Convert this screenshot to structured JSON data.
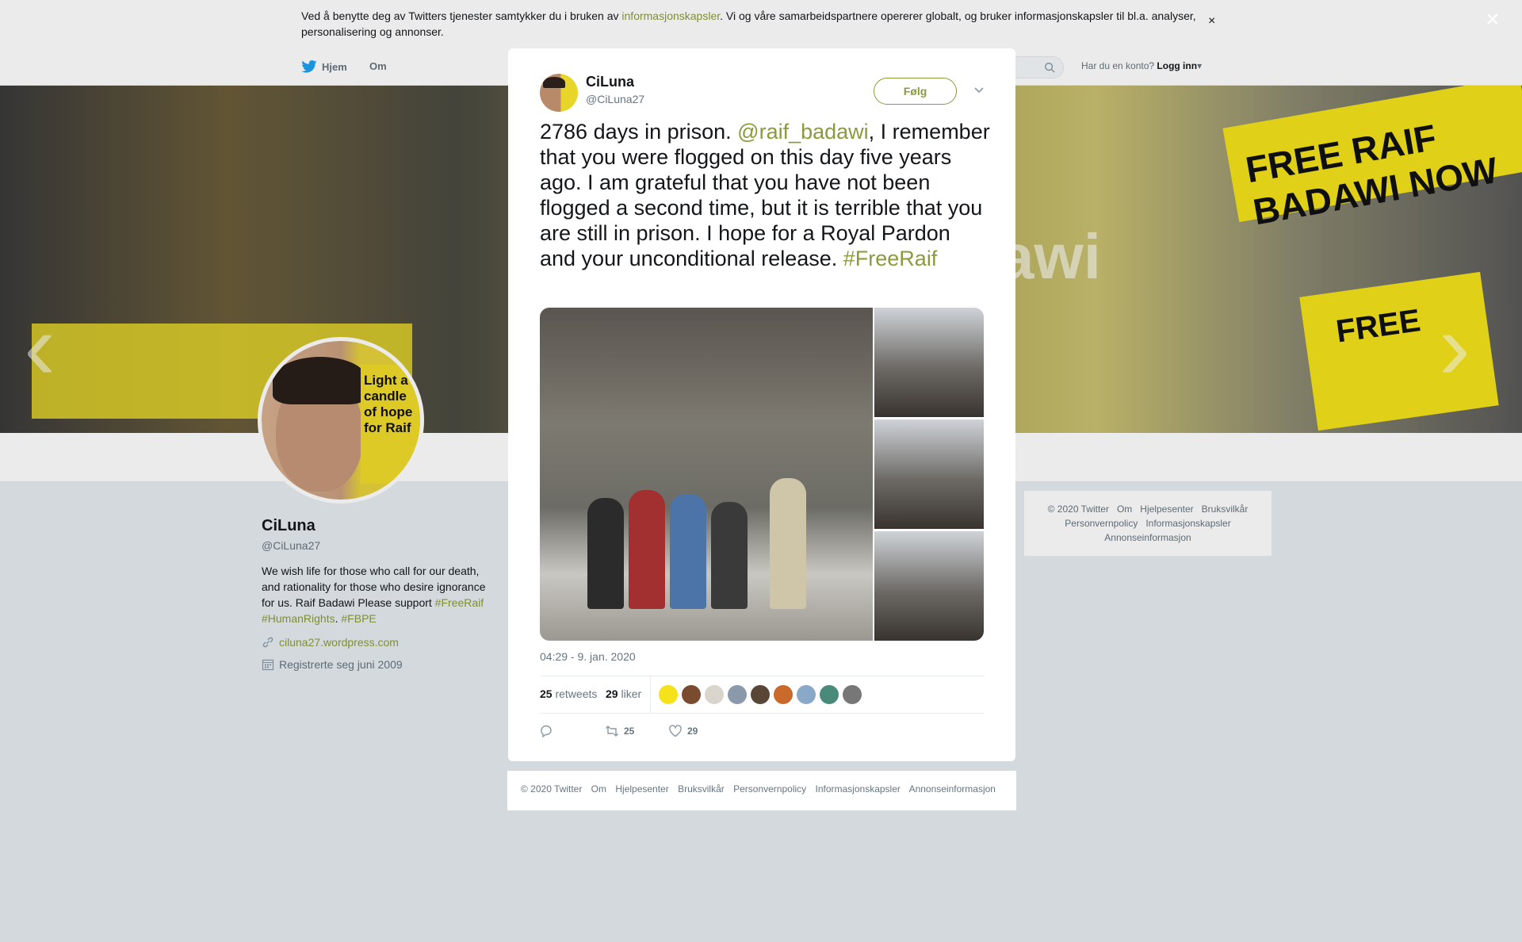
{
  "cookie_bar": {
    "text_before": "Ved å benytte deg av Twitters tjenester samtykker du i bruken av ",
    "link": "informasjonskapsler",
    "text_after": ". Vi og våre samarbeidspartnere opererer globalt, og bruker informasjonskapsler til bl.a. analyser, personalisering og annonser.",
    "close": "×"
  },
  "nav": {
    "home": "Hjem",
    "about": "Om",
    "login_prompt": "Har du en konto?",
    "login": "Logg inn"
  },
  "profile": {
    "name": "CiLuna",
    "handle": "@CiLuna27",
    "bio_text": "We wish life for those who call for our death, and rationality for those who desire ignorance for us. Raif Badawi Please support ",
    "bio_tag1": "#FreeRaif",
    "bio_tag2": "#HumanRights",
    "bio_sep": ". ",
    "bio_tag3": "#FBPE",
    "url": "ciluna27.wordpress.com",
    "joined": "Registrerte seg juni 2009",
    "avatar_sign": "Light a candle of hope for Raif"
  },
  "banner": {
    "sign1": "FREE RAIF BADAWI NOW",
    "sign2": "FREE",
    "fragment": "awi"
  },
  "right_footer": {
    "items": [
      "© 2020 Twitter",
      "Om",
      "Hjelpesenter",
      "Bruksvilkår",
      "Personvernpolicy",
      "Informasjonskapsler",
      "Annonseinformasjon"
    ]
  },
  "overlay_close": "×",
  "tweet": {
    "name": "CiLuna",
    "handle": "@CiLuna27",
    "follow_label": "Følg",
    "text_1": "2786 days in prison. ",
    "mention": "@raif_badawi",
    "text_2": ", I remember that you were flogged on this day five years ago. I am grateful that you have not been flogged a second time, but it is terrible that you are still in prison. I hope for a Royal Pardon and your unconditional release. ",
    "hashtag": "#FreeRaif",
    "timestamp": "04:29 - 9. jan. 2020",
    "retweets_count": "25",
    "retweets_label": "retweets",
    "likes_count": "29",
    "likes_label": "liker",
    "action_retweet_count": "25",
    "action_like_count": "29",
    "liker_colors": [
      "#f5e21a",
      "#7a4b2e",
      "#d9d4cc",
      "#8a9aab",
      "#5a4635",
      "#c96a2a",
      "#8aa8c8",
      "#4a8a7a",
      "#777777"
    ]
  },
  "footer": {
    "items": [
      "© 2020 Twitter",
      "Om",
      "Hjelpesenter",
      "Bruksvilkår",
      "Personvernpolicy",
      "Informasjonskapsler",
      "Annonseinformasjon"
    ]
  },
  "colors": {
    "accent": "#8b9b3a",
    "text": "#14171a",
    "muted": "#66757f"
  }
}
